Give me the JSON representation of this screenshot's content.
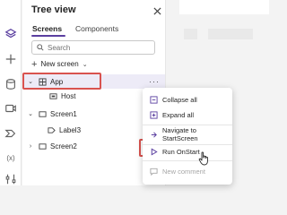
{
  "panel": {
    "title": "Tree view",
    "tabs": [
      {
        "label": "Screens"
      },
      {
        "label": "Components"
      }
    ],
    "search_placeholder": "Search",
    "new_screen_label": "New screen"
  },
  "tree": {
    "items": [
      {
        "label": "App"
      },
      {
        "label": "Host"
      },
      {
        "label": "Screen1"
      },
      {
        "label": "Label3"
      },
      {
        "label": "Screen2"
      }
    ],
    "more_label": "···"
  },
  "context_menu": {
    "items": [
      {
        "label": "Collapse all"
      },
      {
        "label": "Expand all"
      },
      {
        "label": "Navigate to StartScreen"
      },
      {
        "label": "Run OnStart"
      },
      {
        "label": "New comment"
      }
    ]
  },
  "rail": {
    "variables_label": "(x)"
  },
  "colors": {
    "accent": "#5b3fa0",
    "highlight_box": "#d9534f",
    "selected_row": "#edebf7"
  }
}
